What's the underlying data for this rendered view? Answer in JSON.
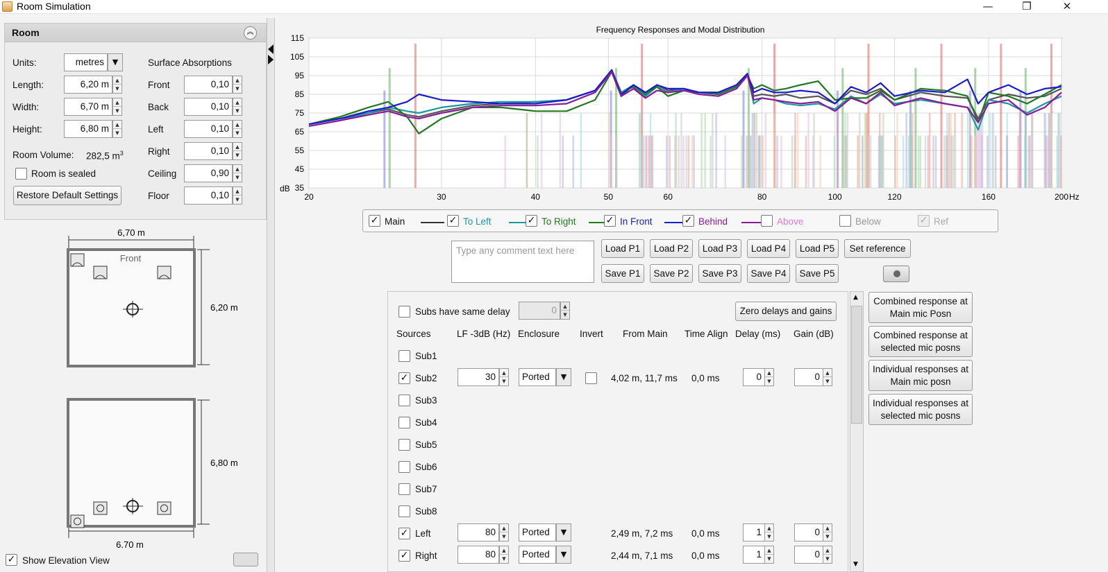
{
  "window": {
    "title": "Room Simulation",
    "minimize": "—",
    "restore": "❐",
    "close": "✕"
  },
  "room": {
    "header": "Room",
    "units_label": "Units:",
    "units_value": "metres",
    "length_label": "Length:",
    "length_value": "6,20 m",
    "width_label": "Width:",
    "width_value": "6,70 m",
    "height_label": "Height:",
    "height_value": "6,80 m",
    "volume_label": "Room Volume:",
    "volume_value": "282,5 m",
    "volume_unit_sup": "3",
    "sealed_label": "Room is sealed",
    "sealed_checked": false,
    "restore_button": "Restore Default Settings",
    "absorptions_title": "Surface Absorptions",
    "surfaces": [
      {
        "label": "Front",
        "value": "0,10"
      },
      {
        "label": "Back",
        "value": "0,10"
      },
      {
        "label": "Left",
        "value": "0,10"
      },
      {
        "label": "Right",
        "value": "0,10"
      },
      {
        "label": "Ceiling",
        "value": "0,90"
      },
      {
        "label": "Floor",
        "value": "0,10"
      }
    ]
  },
  "plan_view": {
    "width_dim": "6,70 m",
    "length_dim": "6,20 m",
    "front_label": "Front"
  },
  "elevation_view": {
    "width_dim": "6.70 m",
    "height_dim": "6,80 m"
  },
  "show_elevation": {
    "label": "Show Elevation View",
    "checked": true
  },
  "chart_data": {
    "type": "line",
    "title": "Frequency Responses and Modal Distribution",
    "y_unit_label": "dB",
    "x_unit_label": "Hz",
    "x_scale": "log",
    "xlim": [
      20,
      200
    ],
    "ylim": [
      35,
      115
    ],
    "x_ticks": [
      20,
      30,
      40,
      50,
      60,
      80,
      100,
      120,
      160,
      200
    ],
    "y_ticks": [
      35,
      45,
      55,
      65,
      75,
      85,
      95,
      105,
      115
    ],
    "grid": true,
    "series": [
      {
        "name": "Main",
        "color": "#555555",
        "x": [
          20,
          22,
          24,
          25.5,
          27,
          28,
          30,
          33,
          36,
          40,
          44,
          48,
          50.5,
          52,
          54,
          56,
          58,
          60,
          63,
          66,
          70,
          74,
          76.5,
          78,
          80,
          83,
          86,
          90,
          95,
          100,
          105,
          110,
          115,
          120,
          130,
          140,
          150,
          155,
          160,
          170,
          180,
          190,
          200
        ],
        "y": [
          69,
          72,
          75,
          77,
          74,
          73,
          76,
          79,
          80,
          81,
          82,
          87,
          98,
          86,
          89,
          84,
          90,
          87,
          88,
          86,
          86,
          90,
          96,
          84,
          85,
          84,
          85,
          83,
          84,
          80,
          87,
          85,
          88,
          82,
          86,
          84,
          83,
          72,
          82,
          85,
          83,
          84,
          88
        ]
      },
      {
        "name": "To Left",
        "color": "#1a9aa0",
        "x": [
          20,
          22,
          24,
          25.5,
          27,
          28,
          30,
          33,
          36,
          40,
          44,
          48,
          50.5,
          52,
          54,
          56,
          58,
          60,
          63,
          66,
          70,
          74,
          76.5,
          78,
          80,
          83,
          86,
          90,
          95,
          100,
          105,
          110,
          115,
          120,
          130,
          140,
          150,
          155,
          160,
          170,
          180,
          190,
          200
        ],
        "y": [
          68,
          71,
          75,
          78,
          76,
          75,
          78,
          80,
          81,
          81,
          82,
          87,
          98,
          86,
          90,
          84,
          89,
          86,
          88,
          86,
          85,
          89,
          96,
          80,
          83,
          82,
          80,
          79,
          80,
          77,
          84,
          80,
          85,
          80,
          82,
          80,
          78,
          66,
          82,
          80,
          75,
          80,
          84
        ]
      },
      {
        "name": "To Right",
        "color": "#1f7a1f",
        "x": [
          20,
          22,
          24,
          25.5,
          27,
          28,
          30,
          33,
          36,
          40,
          44,
          48,
          50.5,
          52,
          54,
          56,
          58,
          60,
          63,
          66,
          70,
          74,
          76.5,
          78,
          80,
          83,
          86,
          90,
          95,
          100,
          105,
          110,
          115,
          120,
          130,
          140,
          150,
          155,
          160,
          170,
          180,
          190,
          200
        ],
        "y": [
          69,
          73,
          78,
          81,
          73,
          64,
          72,
          78,
          78,
          76,
          76,
          82,
          97,
          84,
          90,
          85,
          89,
          84,
          87,
          86,
          85,
          89,
          95,
          88,
          90,
          87,
          88,
          90,
          92,
          82,
          83,
          83,
          87,
          82,
          88,
          87,
          84,
          70,
          86,
          84,
          80,
          85,
          90
        ]
      },
      {
        "name": "In Front",
        "color": "#1a1ad0",
        "x": [
          20,
          22,
          24,
          25.5,
          27,
          28,
          30,
          33,
          36,
          40,
          44,
          48,
          50.5,
          52,
          54,
          56,
          58,
          60,
          63,
          66,
          70,
          74,
          76.5,
          78,
          80,
          83,
          86,
          90,
          95,
          100,
          105,
          110,
          115,
          120,
          130,
          140,
          150,
          155,
          160,
          170,
          180,
          190,
          200
        ],
        "y": [
          69,
          72,
          76,
          78,
          81,
          85,
          82,
          81,
          80,
          80,
          82,
          87,
          98,
          85,
          90,
          86,
          90,
          88,
          88,
          86,
          86,
          90,
          96,
          86,
          88,
          86,
          86,
          87,
          86,
          80,
          89,
          86,
          91,
          84,
          87,
          86,
          93,
          80,
          86,
          90,
          85,
          88,
          89
        ]
      },
      {
        "name": "Behind",
        "color": "#8a1a9a",
        "x": [
          20,
          22,
          24,
          25.5,
          27,
          28,
          30,
          33,
          36,
          40,
          44,
          48,
          50.5,
          52,
          54,
          56,
          58,
          60,
          63,
          66,
          70,
          74,
          76.5,
          78,
          80,
          83,
          86,
          90,
          95,
          100,
          105,
          110,
          115,
          120,
          130,
          140,
          150,
          155,
          160,
          170,
          180,
          190,
          200
        ],
        "y": [
          68,
          71,
          74,
          76,
          73,
          72,
          75,
          78,
          79,
          79,
          80,
          86,
          97,
          84,
          88,
          83,
          87,
          86,
          87,
          85,
          84,
          88,
          95,
          82,
          83,
          82,
          81,
          80,
          81,
          76,
          83,
          80,
          86,
          79,
          83,
          80,
          78,
          70,
          80,
          82,
          74,
          78,
          86
        ]
      }
    ],
    "modal_markers": {
      "description_colors": {
        "axial": "#e08080",
        "tangential": "#80c080",
        "oblique": "#c0c0c0"
      },
      "axial_hz": [
        27.7,
        55.4,
        83.1,
        110.8,
        138.5,
        166.2,
        193.9
      ],
      "length_axial_hz": [
        25.6,
        51.2,
        76.8,
        102.4,
        128.0,
        153.6,
        179.2
      ],
      "width_axial_hz": [
        25.2,
        50.4,
        75.6,
        100.8,
        126.0,
        151.2,
        176.4
      ]
    }
  },
  "legend": [
    {
      "label": "Main",
      "checked": true,
      "color": "#333333",
      "text_color": "#111111",
      "enabled": true
    },
    {
      "label": "To Left",
      "checked": true,
      "color": "#1a9aa0",
      "text_color": "#1a9aa0",
      "enabled": true
    },
    {
      "label": "To Right",
      "checked": true,
      "color": "#1f7a1f",
      "text_color": "#1f7a1f",
      "enabled": true
    },
    {
      "label": "In Front",
      "checked": true,
      "color": "#1a1ad0",
      "text_color": "#1a1ad0",
      "enabled": true
    },
    {
      "label": "Behind",
      "checked": true,
      "color": "#8a1a9a",
      "text_color": "#8a1a9a",
      "enabled": true
    },
    {
      "label": "Above",
      "checked": false,
      "color": "",
      "text_color": "#e07ad8",
      "enabled": true
    },
    {
      "label": "Below",
      "checked": false,
      "color": "",
      "text_color": "#999999",
      "enabled": true
    },
    {
      "label": "Ref",
      "checked": true,
      "color": "",
      "text_color": "#aaaaaa",
      "enabled": false
    }
  ],
  "comment": {
    "placeholder": "Type any comment text here"
  },
  "load_buttons": [
    "Load P1",
    "Load P2",
    "Load P3",
    "Load P4",
    "Load P5"
  ],
  "save_buttons": [
    "Save P1",
    "Save P2",
    "Save P3",
    "Save P4",
    "Save P5"
  ],
  "set_reference": "Set reference",
  "subs": {
    "same_delay_label": "Subs have same delay",
    "same_delay_checked": false,
    "same_delay_value": "0",
    "zero_button": "Zero delays and gains",
    "headers": [
      "Sources",
      "LF -3dB (Hz)",
      "Enclosure",
      "Invert",
      "From Main",
      "Time Align",
      "Delay (ms)",
      "Gain (dB)"
    ],
    "rows": [
      {
        "name": "Sub1",
        "checked": false
      },
      {
        "name": "Sub2",
        "checked": true,
        "lf": "30",
        "enclosure": "Ported",
        "invert": false,
        "from_main": "4,02 m, 11,7 ms",
        "time_align": "0,0 ms",
        "delay": "0",
        "gain": "0"
      },
      {
        "name": "Sub3",
        "checked": false
      },
      {
        "name": "Sub4",
        "checked": false
      },
      {
        "name": "Sub5",
        "checked": false
      },
      {
        "name": "Sub6",
        "checked": false
      },
      {
        "name": "Sub7",
        "checked": false
      },
      {
        "name": "Sub8",
        "checked": false
      },
      {
        "name": "Left",
        "checked": true,
        "lf": "80",
        "enclosure": "Ported",
        "from_main": "2,49 m, 7,2 ms",
        "time_align": "0,0 ms",
        "delay": "1",
        "gain": "0"
      },
      {
        "name": "Right",
        "checked": true,
        "lf": "80",
        "enclosure": "Ported",
        "from_main": "2,44 m, 7,1 ms",
        "time_align": "0,0 ms",
        "delay": "1",
        "gain": "0"
      }
    ]
  },
  "response_buttons": [
    {
      "line1": "Combined response at",
      "line2": "Main mic Posn"
    },
    {
      "line1": "Combined response at",
      "line2": "selected mic posns"
    },
    {
      "line1": "Individual responses at",
      "line2": "Main mic posn"
    },
    {
      "line1": "Individual responses at",
      "line2": "selected mic posns"
    }
  ]
}
